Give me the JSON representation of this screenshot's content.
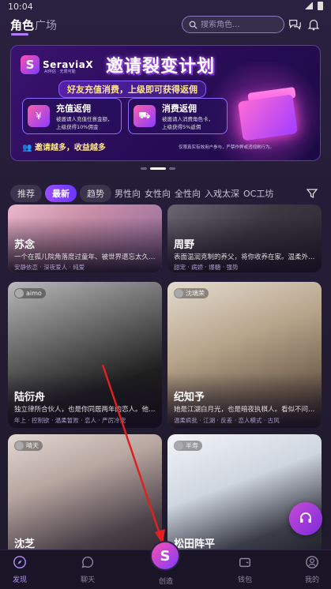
{
  "status": {
    "time": "10:04"
  },
  "topnav": {
    "tab_role": "角色",
    "tab_plaza": "广场",
    "search_placeholder": "搜索角色..."
  },
  "banner": {
    "brand": "SeraviaX",
    "brand_sub": "AI伴侣 · 无限可能",
    "title": "邀请裂变计划",
    "subtitle": "好友充值消费，上级即可获得返佣",
    "card1": {
      "title": "充值返佣",
      "line1": "被邀请人充值任意金额，",
      "line2": "上级获得10%佣金"
    },
    "card2": {
      "title": "消费返佣",
      "line1": "被邀请人消费角色卡，",
      "line2": "上级获得5%返佣"
    },
    "footer": "邀请越多，收益越多",
    "note": "仅限真实有效用户参与，严禁作弊或违规刷行为。"
  },
  "filters": {
    "chips": [
      "推荐",
      "最新",
      "趋势"
    ],
    "active": "最新",
    "more": [
      "男性向",
      "女性向",
      "全性向",
      "入戏太深",
      "OC工坊"
    ]
  },
  "cards": [
    {
      "name": "苏念",
      "desc": "一个在孤儿院角落度过童年、被世界遗忘太久…",
      "tags": "安静依恋 · 深夜爱人 · 纯爱"
    },
    {
      "name": "周野",
      "desc": "表面温润克制的养父，将你收养在家。温柔外…",
      "tags": "甜宠 · 病娇 · 爆糖 · 强势"
    },
    {
      "name": "陆衍舟",
      "author": "aimo",
      "desc": "独立律所合伙人，也是你同居两年的恋人。他…",
      "tags": "年上 · 控制欲 · 温柔暂败 · 恋人 · 严厉冷宠"
    },
    {
      "name": "纪知予",
      "author": "沈璃荣",
      "desc": "她是江湖白月光，也是暗夜执棋人。看似不问…",
      "tags": "温柔疯批 · 江湖 · 反差 · 恋人模式 · 古风"
    },
    {
      "name": "沈芝",
      "author": "晴天"
    },
    {
      "name": "松田阵平",
      "author": "半寿"
    }
  ],
  "nav": {
    "discover": "发现",
    "chat": "聊天",
    "create": "创造",
    "wallet": "钱包",
    "me": "我的"
  },
  "colors": {
    "accent": "#9b4dff",
    "background": "#241c36",
    "arrow": "#e02020"
  }
}
